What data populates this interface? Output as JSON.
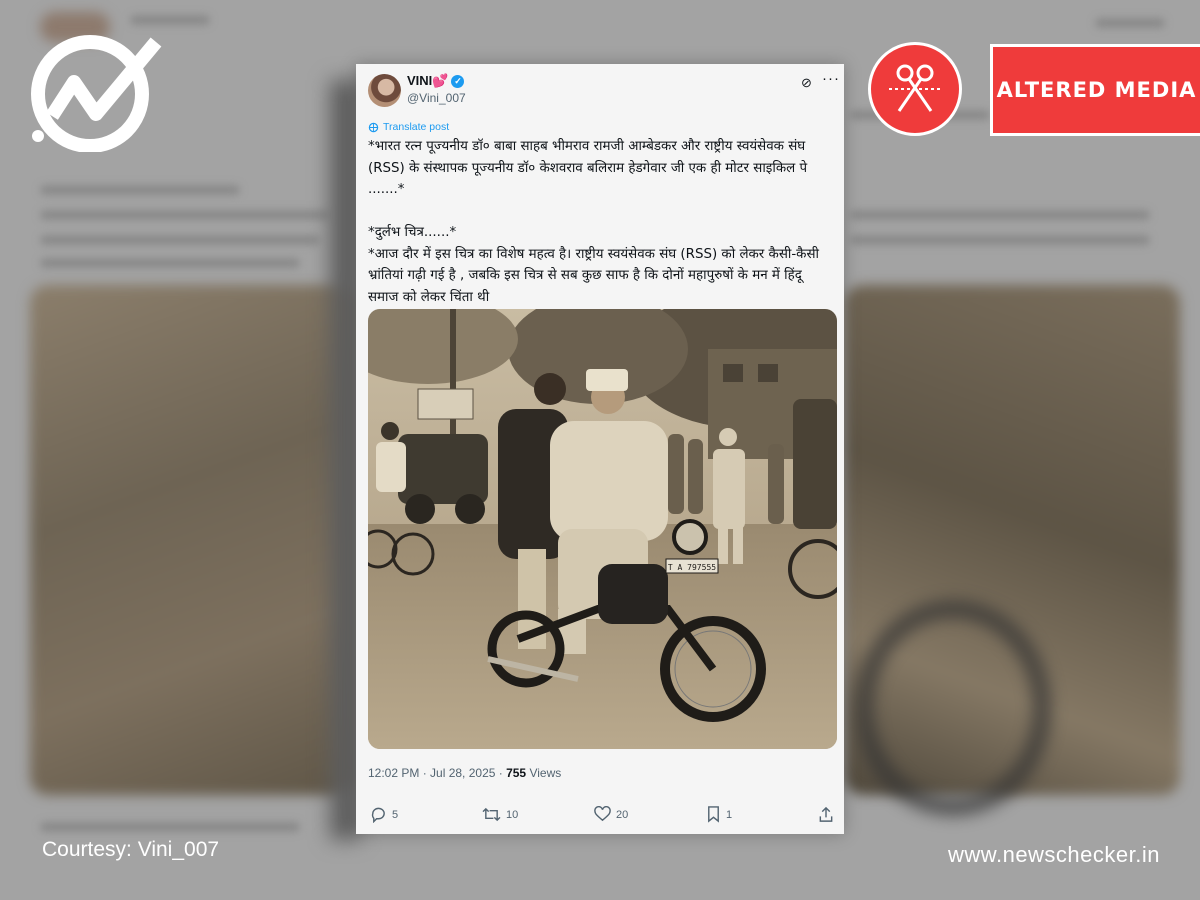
{
  "overlay": {
    "badge_label": "ALTERED MEDIA",
    "courtesy": "Courtesy: Vini_007",
    "site": "www.newschecker.in",
    "accent_color": "#ef3b3b",
    "icons": [
      "newschecker-logo-icon",
      "scissors-icon"
    ]
  },
  "tweet": {
    "author_name": "VINI💕",
    "handle": "@Vini_007",
    "translate_label": "Translate post",
    "text": "*भारत रत्न पूज्यनीय डॉ० बाबा साहब भीमराव रामजी आम्बेडकर और राष्ट्रीय स्वयंसेवक संघ (RSS) के संस्थापक पूज्यनीय डॉ० केशवराव बलिराम हेडगेवार जी एक ही मोटर साइकिल पे .......*\n\n*दुर्लभ चित्र......*\n*आज दौर में इस चित्र का विशेष महत्व है। राष्ट्रीय स्वयंसेवक संघ (RSS) को लेकर कैसी-कैसी भ्रांतियां गढ़ी गई है , जबकि इस चित्र से सब कुछ साफ है कि दोनों महापुरुषों के मन में हिंदू  समाज को लेकर चिंता थी",
    "time": "12:02 PM · Jul 28, 2025 · ",
    "views_count": "755",
    "views_label": " Views",
    "license_plate": "T A 797555",
    "replies": "5",
    "reposts": "10",
    "likes": "20",
    "bookmarks": "1",
    "verified_color": "#1d9bf0"
  }
}
